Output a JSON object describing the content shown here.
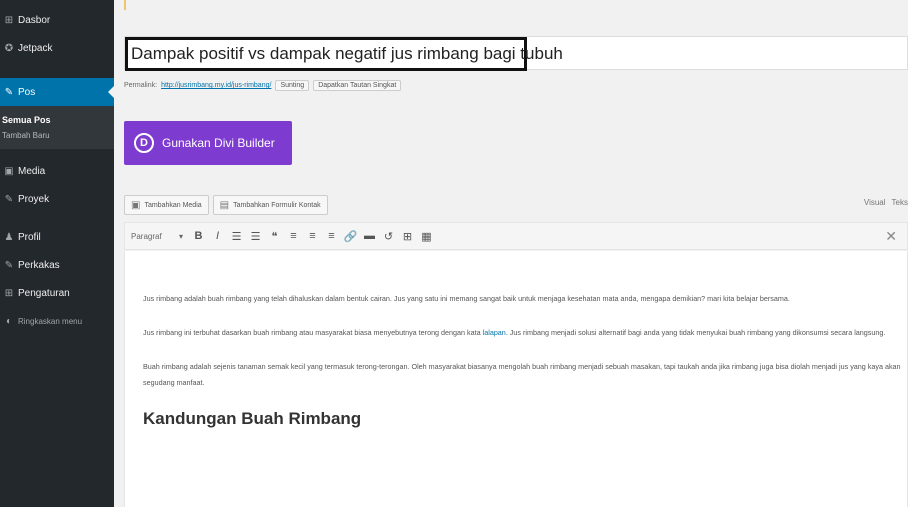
{
  "sidebar": {
    "items": [
      {
        "icon": "⊞",
        "label": "Dasbor"
      },
      {
        "icon": "✪",
        "label": "Jetpack"
      },
      {
        "icon": "✎",
        "label": "Pos",
        "active": true
      }
    ],
    "sub": {
      "current": "Semua Pos",
      "next": "Tambah Baru"
    },
    "items2": [
      {
        "icon": "▣",
        "label": "Media"
      },
      {
        "icon": "✎",
        "label": "Proyek"
      },
      {
        "icon": "♟",
        "label": "Profil"
      },
      {
        "icon": "✎",
        "label": "Perkakas"
      },
      {
        "icon": "⊞",
        "label": "Pengaturan"
      },
      {
        "icon": "◐",
        "label": "Ringkaskan menu"
      }
    ]
  },
  "editor": {
    "title": "Dampak positif vs dampak negatif jus rimbang bagi tubuh",
    "permalink": {
      "label": "Permalink:",
      "url": "http://jusrimbang.my.id/jus-rimbang/",
      "edit_label": "Sunting",
      "view_label": "Dapatkan Tautan Singkat"
    },
    "divi_label": "Gunakan Divi Builder",
    "divi_letter": "D",
    "media_btn": "Tambahkan Media",
    "form_btn": "Tambahkan Formulir Kontak",
    "tab_visual": "Visual",
    "tab_text": "Teks",
    "format_select": "Paragraf",
    "toolbar_buttons": [
      "B",
      "I",
      "☰",
      "☰",
      "❝",
      "≡",
      "≡",
      "≡",
      "🔗",
      "▬",
      "↺",
      "⊞",
      "▦"
    ],
    "close": "✕",
    "paragraphs": [
      "Jus rimbang adalah buah rimbang yang telah dihaluskan dalam bentuk cairan. Jus yang satu ini memang sangat baik untuk menjaga kesehatan mata anda, mengapa demikian? mari kita belajar bersama.",
      "Jus rimbang ini terbuhat dasarkan buah rimbang atau masyarakat biasa menyebutnya terong dengan kata",
      "Buah rimbang adalah sejenis tanaman semak kecil yang termasuk terong-terongan. Oleh masyarakat biasanya mengolah buah rimbang menjadi sebuah masakan, tapi taukah anda jika rimbang juga bisa diolah menjadi jus yang kaya akan segudang manfaat."
    ],
    "para2_link": "lalapan",
    "para2_rest": ". Jus rimbang menjadi solusi alternatif bagi anda yang tidak menyukai buah rimbang yang dikonsumsi secara langsung.",
    "heading": "Kandungan Buah Rimbang"
  }
}
